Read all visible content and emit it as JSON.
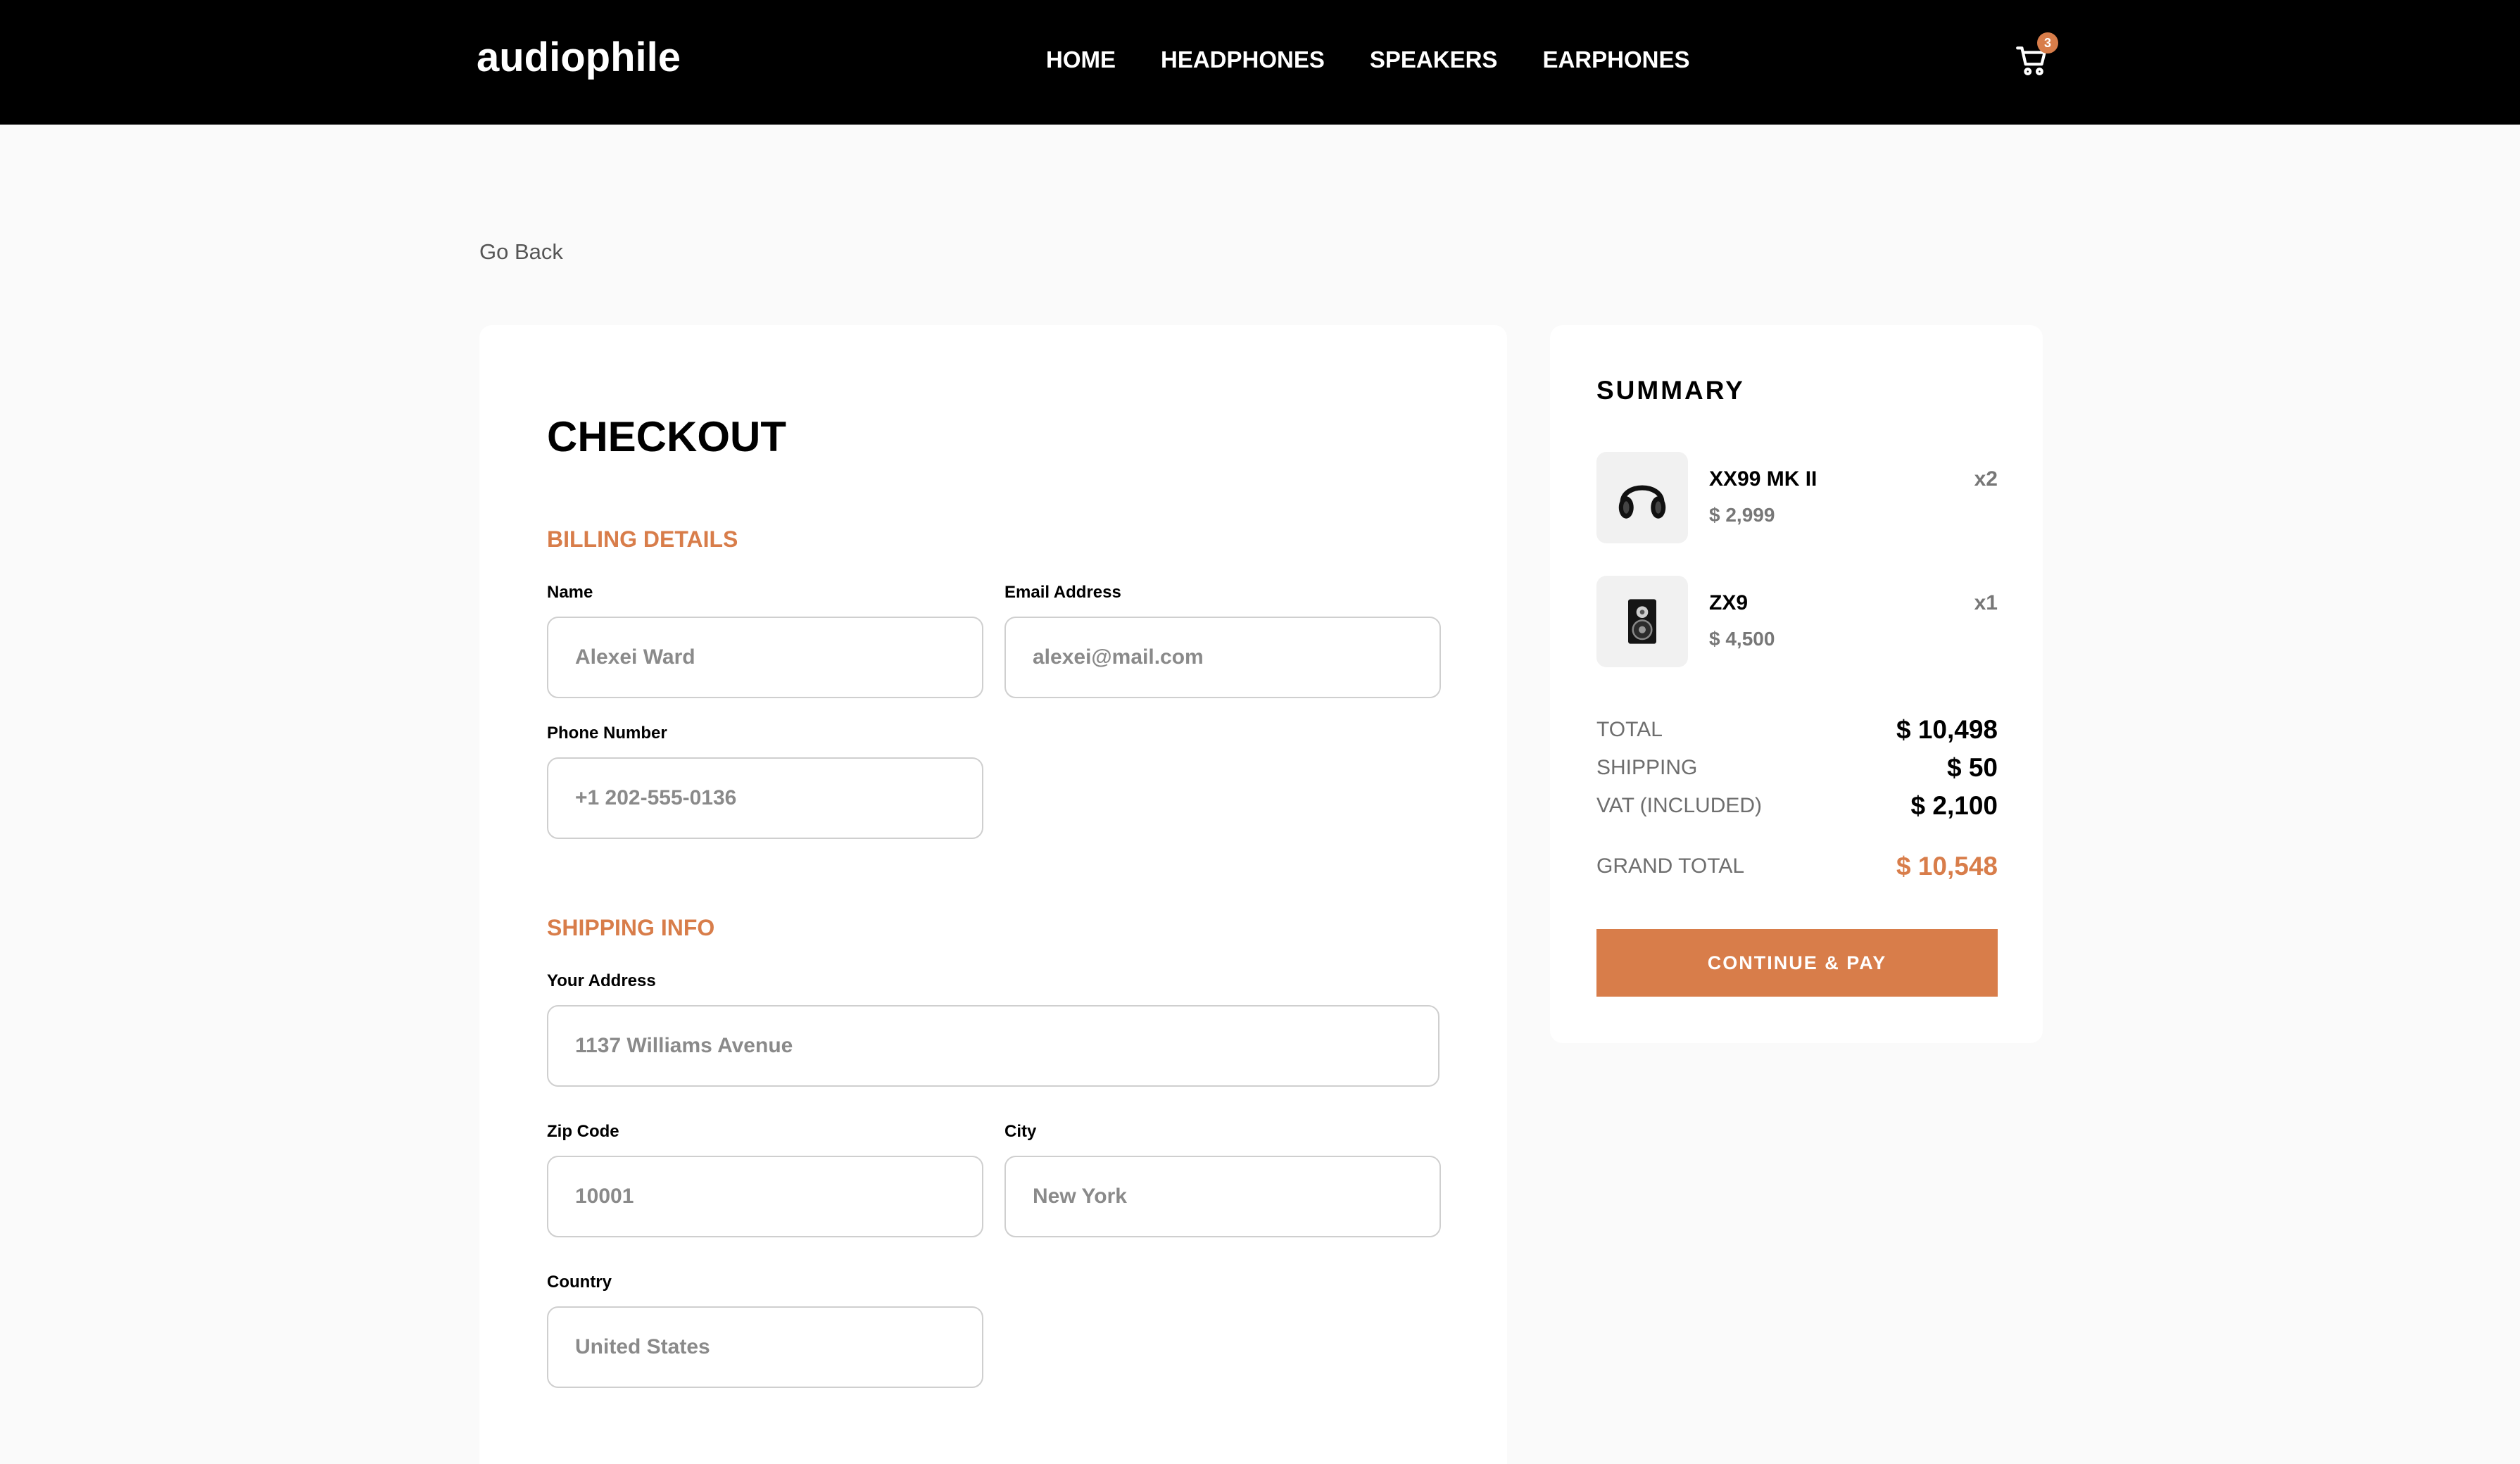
{
  "nav": {
    "logo": "audiophile",
    "links": [
      "HOME",
      "HEADPHONES",
      "SPEAKERS",
      "EARPHONES"
    ],
    "cart_count": "3"
  },
  "go_back": "Go Back",
  "checkout": {
    "title": "CHECKOUT",
    "billing": {
      "title": "BILLING DETAILS",
      "name_label": "Name",
      "name_placeholder": "Alexei Ward",
      "email_label": "Email Address",
      "email_placeholder": "alexei@mail.com",
      "phone_label": "Phone Number",
      "phone_placeholder": "+1 202-555-0136"
    },
    "shipping": {
      "title": "SHIPPING INFO",
      "address_label": "Your Address",
      "address_placeholder": "1137 Williams Avenue",
      "zip_label": "Zip Code",
      "zip_placeholder": "10001",
      "city_label": "City",
      "city_placeholder": "New York",
      "country_label": "Country",
      "country_placeholder": "United States"
    }
  },
  "summary": {
    "title": "SUMMARY",
    "items": [
      {
        "name": "XX99 MK II",
        "price": "$ 2,999",
        "qty": "x2",
        "icon": "headphones-icon"
      },
      {
        "name": "ZX9",
        "price": "$ 4,500",
        "qty": "x1",
        "icon": "speaker-icon"
      }
    ],
    "total_label": "TOTAL",
    "total_value": "$ 10,498",
    "shipping_label": "SHIPPING",
    "shipping_value": "$ 50",
    "vat_label": "VAT (INCLUDED)",
    "vat_value": "$ 2,100",
    "grand_total_label": "GRAND TOTAL",
    "grand_total_value": "$ 10,548",
    "pay_button": "CONTINUE & PAY"
  },
  "colors": {
    "accent": "#d87d4a",
    "nav_background": "#000000",
    "page_background": "#fafafa"
  }
}
